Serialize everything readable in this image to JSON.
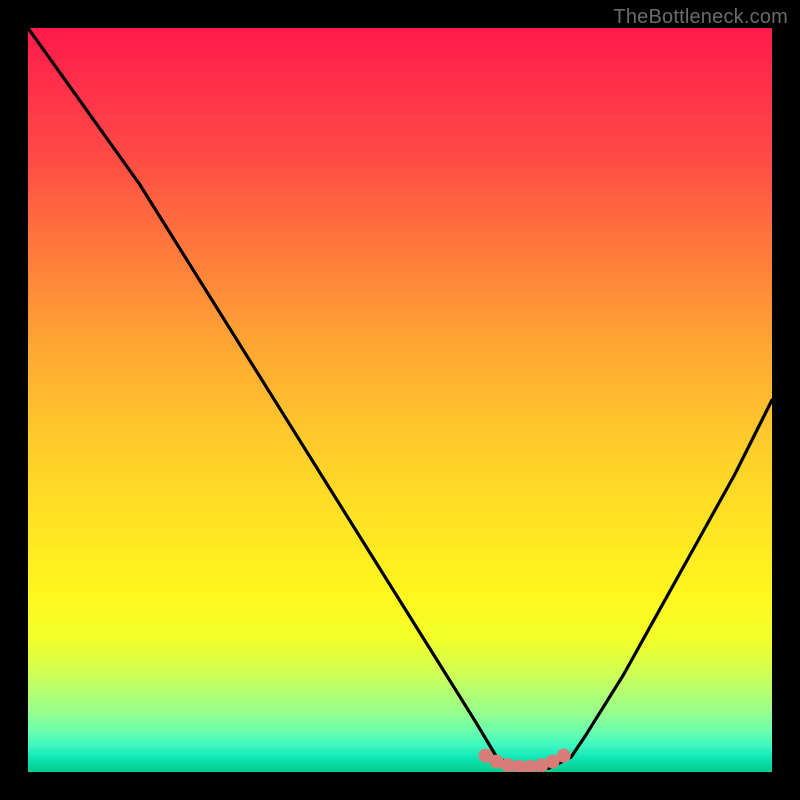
{
  "watermark": "TheBottleneck.com",
  "colors": {
    "frame": "#000000",
    "curve": "#000000",
    "marker": "#d97c79",
    "gradient_top": "#ff1a4b",
    "gradient_bottom": "#04cc8e"
  },
  "chart_data": {
    "type": "line",
    "title": "",
    "xlabel": "",
    "ylabel": "",
    "xlim": [
      0,
      100
    ],
    "ylim": [
      0,
      100
    ],
    "series": [
      {
        "name": "bottleneck-curve",
        "x": [
          0,
          5,
          10,
          15,
          20,
          25,
          30,
          35,
          40,
          45,
          50,
          55,
          60,
          63,
          66,
          70,
          73,
          75,
          80,
          85,
          90,
          95,
          100
        ],
        "values": [
          100,
          93,
          86,
          79,
          71,
          63,
          55,
          47,
          39,
          31,
          23,
          15,
          7,
          2.0,
          0.5,
          0.5,
          2.0,
          5,
          13,
          22,
          31,
          40,
          50
        ]
      }
    ],
    "markers": {
      "name": "highlighted-minimum",
      "x": [
        61.5,
        63.0,
        64.5,
        66.0,
        67.5,
        69.0,
        70.5,
        72.0
      ],
      "values": [
        2.2,
        1.4,
        0.9,
        0.7,
        0.7,
        0.9,
        1.4,
        2.2
      ]
    },
    "background": {
      "type": "vertical-gradient",
      "meaning": "bottleneck-severity",
      "stops": [
        {
          "pos": 0.0,
          "color": "#ff1a4b"
        },
        {
          "pos": 0.5,
          "color": "#ffc72c"
        },
        {
          "pos": 0.8,
          "color": "#fff71e"
        },
        {
          "pos": 1.0,
          "color": "#04cc8e"
        }
      ]
    }
  }
}
